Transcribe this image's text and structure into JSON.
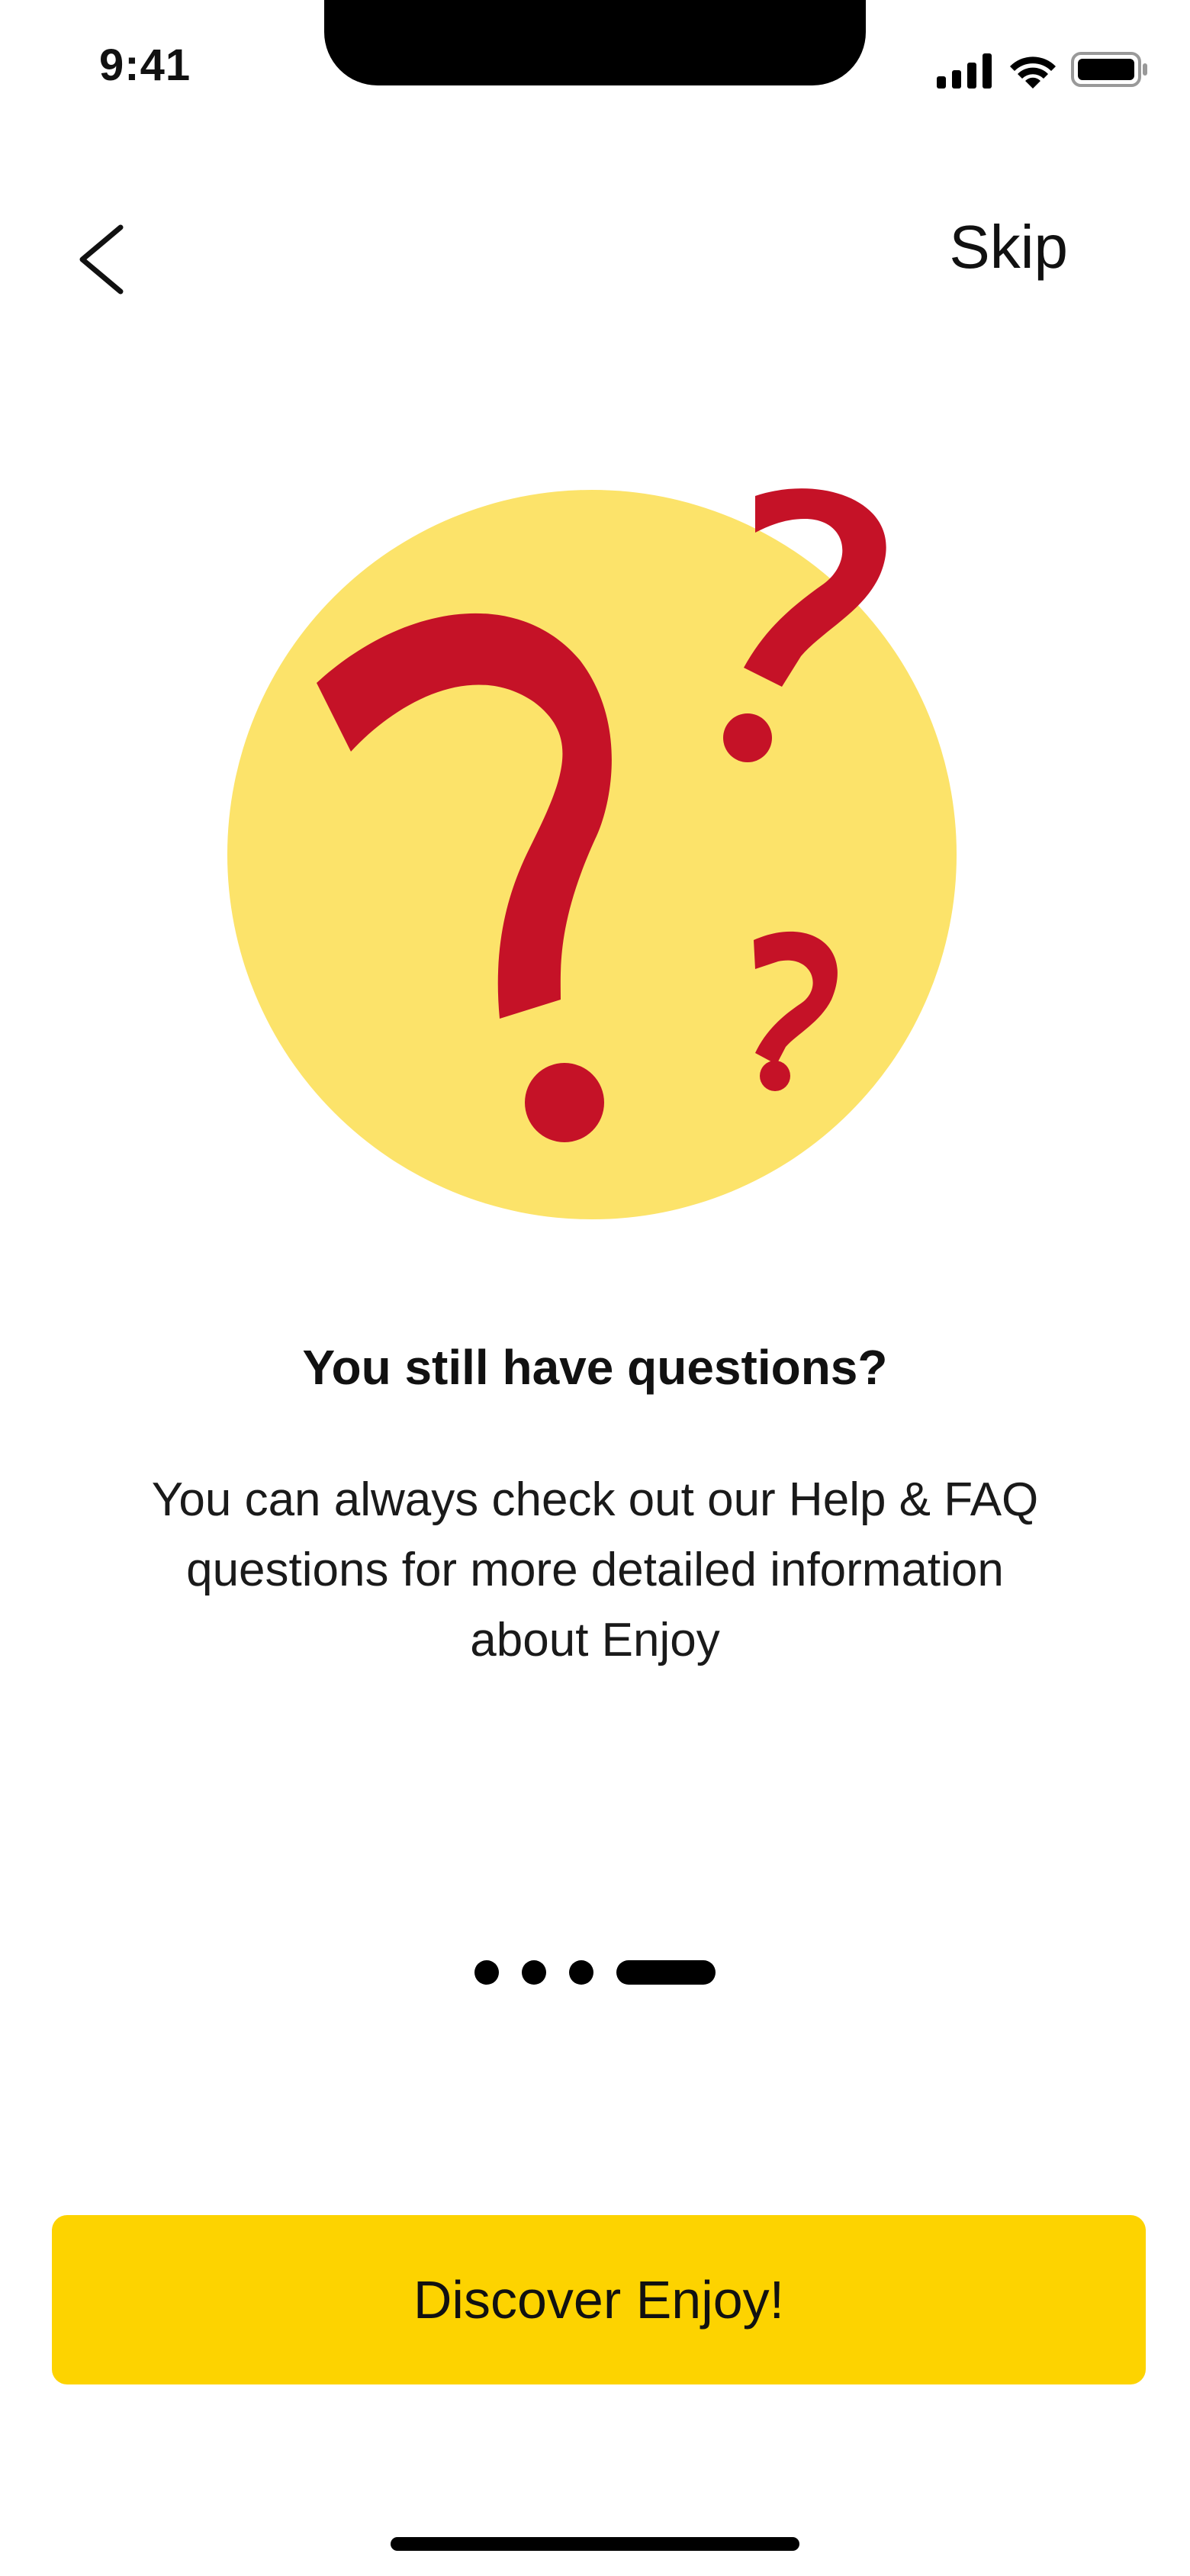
{
  "status_bar": {
    "time": "9:41",
    "icons": [
      "signal-icon",
      "wifi-icon",
      "battery-icon"
    ]
  },
  "nav": {
    "back_icon": "chevron-left-icon",
    "skip_label": "Skip"
  },
  "illustration": {
    "icon": "question-marks-icon",
    "circle_color": "#FCE36A",
    "mark_color": "#C51227"
  },
  "content": {
    "headline": "You still have questions?",
    "body": "You can always check out our Help & FAQ questions for more detailed information about Enjoy"
  },
  "pager": {
    "total_pages": 4,
    "current_page": 4
  },
  "cta": {
    "label": "Discover Enjoy!",
    "color": "#FDD300"
  }
}
